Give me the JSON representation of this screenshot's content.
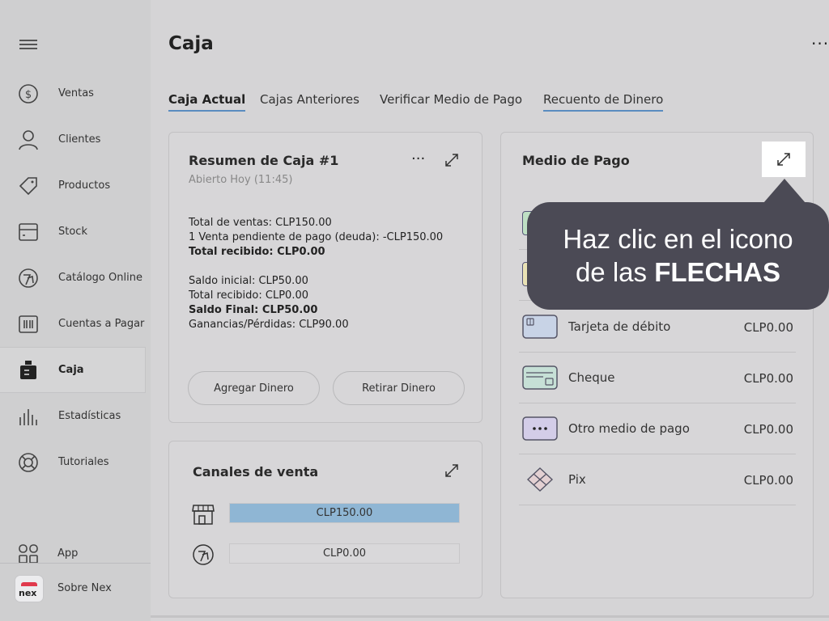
{
  "sidebar": {
    "items": [
      {
        "label": "Ventas",
        "icon": "dollar-circle-icon"
      },
      {
        "label": "Clientes",
        "icon": "user-icon"
      },
      {
        "label": "Productos",
        "icon": "tag-icon"
      },
      {
        "label": "Stock",
        "icon": "box-icon"
      },
      {
        "label": "Catálogo Online",
        "icon": "catalog-icon"
      },
      {
        "label": "Cuentas a Pagar",
        "icon": "barcode-icon"
      },
      {
        "label": "Caja",
        "icon": "register-icon"
      },
      {
        "label": "Estadísticas",
        "icon": "bar-chart-icon"
      },
      {
        "label": "Tutoriales",
        "icon": "lifebuoy-icon"
      }
    ],
    "app_label": "App",
    "about_label": "Sobre Nex",
    "logo_text": "nex"
  },
  "header": {
    "title": "Caja",
    "more": "···"
  },
  "tabs": [
    {
      "label": "Caja Actual"
    },
    {
      "label": "Cajas Anteriores"
    },
    {
      "label": "Verificar Medio de Pago"
    },
    {
      "label": "Recuento de Dinero"
    }
  ],
  "summary": {
    "title": "Resumen de Caja #1",
    "opened": "Abierto Hoy (11:45)",
    "more": "···",
    "lines1": [
      "Total de ventas: CLP150.00",
      "1 Venta pendiente de pago (deuda): -CLP150.00",
      "Total recibido: CLP0.00"
    ],
    "lines2": [
      "Saldo inicial: CLP50.00",
      "Total recibido: CLP0.00",
      "Saldo Final: CLP50.00",
      "Ganancias/Pérdidas: CLP90.00"
    ],
    "add_button": "Agregar Dinero",
    "withdraw_button": "Retirar Dinero"
  },
  "channels": {
    "title": "Canales de venta",
    "rows": [
      {
        "value": "CLP150.00",
        "fill": 1.0,
        "icon": "store-icon"
      },
      {
        "value": "CLP0.00",
        "fill": 0.0,
        "icon": "catalog-icon"
      }
    ]
  },
  "payments": {
    "title": "Medio de Pago",
    "rows": [
      {
        "name": "Tarjeta de débito",
        "value": "CLP0.00",
        "icon": "card-icon"
      },
      {
        "name": "Cheque",
        "value": "CLP0.00",
        "icon": "cheque-icon"
      },
      {
        "name": "Otro medio de pago",
        "value": "CLP0.00",
        "icon": "ellipsis-icon"
      },
      {
        "name": "Pix",
        "value": "CLP0.00",
        "icon": "pix-icon"
      }
    ]
  },
  "tooltip": {
    "line1": "Haz clic en el icono",
    "line2_prefix": "de las ",
    "line2_bold": "FLECHAS"
  },
  "colors": {
    "accent": "#5a8cc0",
    "bar_fill": "#8fb6d4",
    "tooltip_bg": "#4b4a55"
  }
}
